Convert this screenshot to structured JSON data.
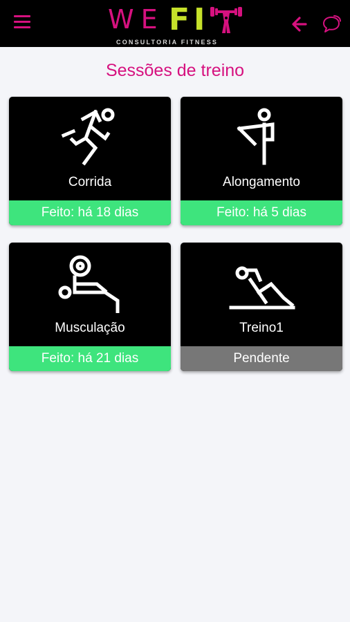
{
  "header": {
    "logo": {
      "we": "WE",
      "fi": "FI",
      "subtitle": "CONSULTORIA FITNESS"
    },
    "menu_icon": "menu-icon",
    "back_icon": "arrow-left-icon",
    "chat_icon": "chat-bubbles-icon"
  },
  "page": {
    "title": "Sessões de treino"
  },
  "sessions": [
    {
      "label": "Corrida",
      "status": "Feito: há 18 dias",
      "state": "done",
      "icon": "running-icon"
    },
    {
      "label": "Alongamento",
      "status": "Feito: há 5 dias",
      "state": "done",
      "icon": "stretching-icon"
    },
    {
      "label": "Musculação",
      "status": "Feito: há 21 dias",
      "state": "done",
      "icon": "weightlifting-icon"
    },
    {
      "label": "Treino1",
      "status": "Pendente",
      "state": "pending",
      "icon": "situp-icon"
    }
  ],
  "colors": {
    "brand_pink": "#d6117f",
    "brand_lime": "#c6e12a",
    "done_green": "#3ee47d",
    "pending_gray": "#777777"
  }
}
